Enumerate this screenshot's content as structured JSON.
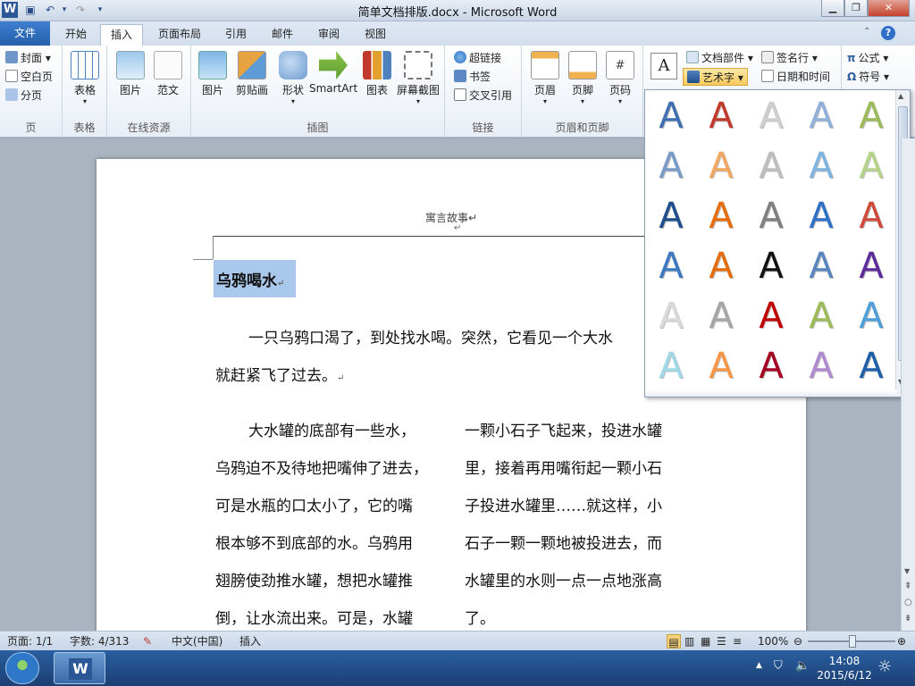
{
  "window": {
    "title": "简单文档排版.docx - Microsoft Word",
    "app_icon": "W"
  },
  "tabs": {
    "file": "文件",
    "items": [
      "开始",
      "插入",
      "页面布局",
      "引用",
      "邮件",
      "审阅",
      "视图"
    ],
    "active": "插入"
  },
  "ribbon": {
    "page_group": {
      "label": "页",
      "items": [
        "封面",
        "空白页",
        "分页"
      ]
    },
    "table_group": {
      "label": "表格",
      "button": "表格"
    },
    "online_group": {
      "label": "在线资源",
      "buttons": [
        "图片",
        "范文"
      ]
    },
    "illus_group": {
      "label": "插图",
      "buttons": [
        "图片",
        "剪贴画",
        "形状",
        "SmartArt",
        "图表",
        "屏幕截图"
      ]
    },
    "link_group": {
      "label": "链接",
      "items": [
        "超链接",
        "书签",
        "交叉引用"
      ]
    },
    "hf_group": {
      "label": "页眉和页脚",
      "buttons": [
        "页眉",
        "页脚",
        "页码"
      ]
    },
    "text_group": {
      "items": [
        "文档部件",
        "艺术字",
        "签名行",
        "日期和时间"
      ]
    },
    "symbol_group": {
      "items": [
        "公式",
        "符号"
      ]
    }
  },
  "document": {
    "header": "寓言故事",
    "title": "乌鸦喝水",
    "para1_line1": "一只乌鸦口渴了，到处找水喝。突然，它看见一个大水",
    "para1_line2": "就赶紧飞了过去。",
    "col1": [
      "大水罐的底部有一些水，",
      "乌鸦迫不及待地把嘴伸了进去，",
      "可是水瓶的口太小了，它的嘴",
      "根本够不到底部的水。乌鸦用",
      "翅膀使劲推水罐，想把水罐推",
      "倒，让水流出来。可是，水罐"
    ],
    "col2": [
      "一颗小石子飞起来，投进水罐",
      "里，接着再用嘴衔起一颗小石",
      "子投进水罐里……就这样，小",
      "石子一颗一颗地被投进去，而",
      "水罐里的水则一点一点地涨高",
      "了。"
    ]
  },
  "wordart_gallery": {
    "glyph": "A",
    "colors": [
      [
        "#3f6fb0",
        "#c0392b",
        "#cfcfcf",
        "#8fb0d8",
        "#9bbb59"
      ],
      [
        "#7a9ac8",
        "#f0a860",
        "#bdbdbd",
        "#7fb3e0",
        "#b6d38a"
      ],
      [
        "#1f4e8c",
        "#e46c0a",
        "#7f7f7f",
        "#2e6fc8",
        "#d04a3c"
      ],
      [
        "#3d78c0",
        "#e36c09",
        "#111111",
        "#5a86bf",
        "#5b2c9a"
      ],
      [
        "#d9d9d9",
        "#a6a6a6",
        "#c00000",
        "#9bbb59",
        "#4f9fd9"
      ],
      [
        "#9fd8e6",
        "#f79646",
        "#a50021",
        "#b08ad0",
        "#1f5fa8"
      ]
    ]
  },
  "status": {
    "page": "页面: 1/1",
    "words": "字数: 4/313",
    "lang": "中文(中国)",
    "mode": "插入",
    "zoom": "100%"
  },
  "taskbar": {
    "time": "14:08",
    "date": "2015/6/12"
  }
}
